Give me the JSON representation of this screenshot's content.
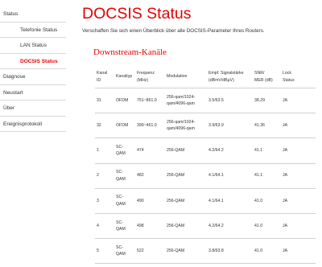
{
  "sidebar": {
    "items": [
      {
        "label": "Status",
        "level": 1,
        "active": false
      },
      {
        "label": "Telefonie Status",
        "level": 2,
        "active": false
      },
      {
        "label": "LAN Status",
        "level": 2,
        "active": false
      },
      {
        "label": "DOCSIS Status",
        "level": 2,
        "active": true
      },
      {
        "label": "Diagnose",
        "level": 1,
        "active": false
      },
      {
        "label": "Neustart",
        "level": 1,
        "active": false
      },
      {
        "label": "Über",
        "level": 1,
        "active": false
      },
      {
        "label": "Ereignisprotokoll",
        "level": 1,
        "active": false
      }
    ]
  },
  "main": {
    "title": "DOCSIS Status",
    "intro": "Verschaffen Sie sich einen Überblick über alle DOCSIS-Parameter Ihres Routers.",
    "section_title": "Downstream-Kanäle"
  },
  "table": {
    "headers": [
      [
        "Kanal",
        "ID"
      ],
      [
        "Kanaltyp"
      ],
      [
        "Frequenz",
        "(MHz)"
      ],
      [
        "Modulation"
      ],
      [
        "Empf. Signalstärke",
        "(dBmV/dBµV)"
      ],
      [
        "SNR/",
        "MER (dB)"
      ],
      [
        "Lock",
        "Status"
      ]
    ],
    "rows": [
      [
        [
          "31"
        ],
        [
          "OFDM"
        ],
        [
          "751~861.0"
        ],
        [
          "256-qam/1024-",
          "qam/4096-qam"
        ],
        [
          "3.5/63.5"
        ],
        [
          "38.29"
        ],
        [
          "JA"
        ]
      ],
      [
        [
          "32"
        ],
        [
          "OFDM"
        ],
        [
          "399~461.0"
        ],
        [
          "256-qam/1024-",
          "qam/4096-qam"
        ],
        [
          "3.9/63.9"
        ],
        [
          "41.36"
        ],
        [
          "JA"
        ]
      ],
      [
        [
          "1"
        ],
        [
          "SC-",
          "QAM"
        ],
        [
          "474"
        ],
        [
          "256-QAM"
        ],
        [
          "4.2/64.2"
        ],
        [
          "41.1"
        ],
        [
          "JA"
        ]
      ],
      [
        [
          "2"
        ],
        [
          "SC-",
          "QAM"
        ],
        [
          "482"
        ],
        [
          "256-QAM"
        ],
        [
          "4.1/64.1"
        ],
        [
          "41.1"
        ],
        [
          "JA"
        ]
      ],
      [
        [
          "3"
        ],
        [
          "SC-",
          "QAM"
        ],
        [
          "490"
        ],
        [
          "256-QAM"
        ],
        [
          "4.1/64.1"
        ],
        [
          "41.0"
        ],
        [
          "JA"
        ]
      ],
      [
        [
          "4"
        ],
        [
          "SC-",
          "QAM"
        ],
        [
          "498"
        ],
        [
          "256-QAM"
        ],
        [
          "4.2/64.2"
        ],
        [
          "41.0"
        ],
        [
          "JA"
        ]
      ],
      [
        [
          "5"
        ],
        [
          "SC-",
          "QAM"
        ],
        [
          "522"
        ],
        [
          "256-QAM"
        ],
        [
          "3.8/63.8"
        ],
        [
          "41.0"
        ],
        [
          "JA"
        ]
      ]
    ]
  },
  "colors": {
    "accent": "#e60000",
    "text": "#333333",
    "divider": "#d0d0d0"
  }
}
